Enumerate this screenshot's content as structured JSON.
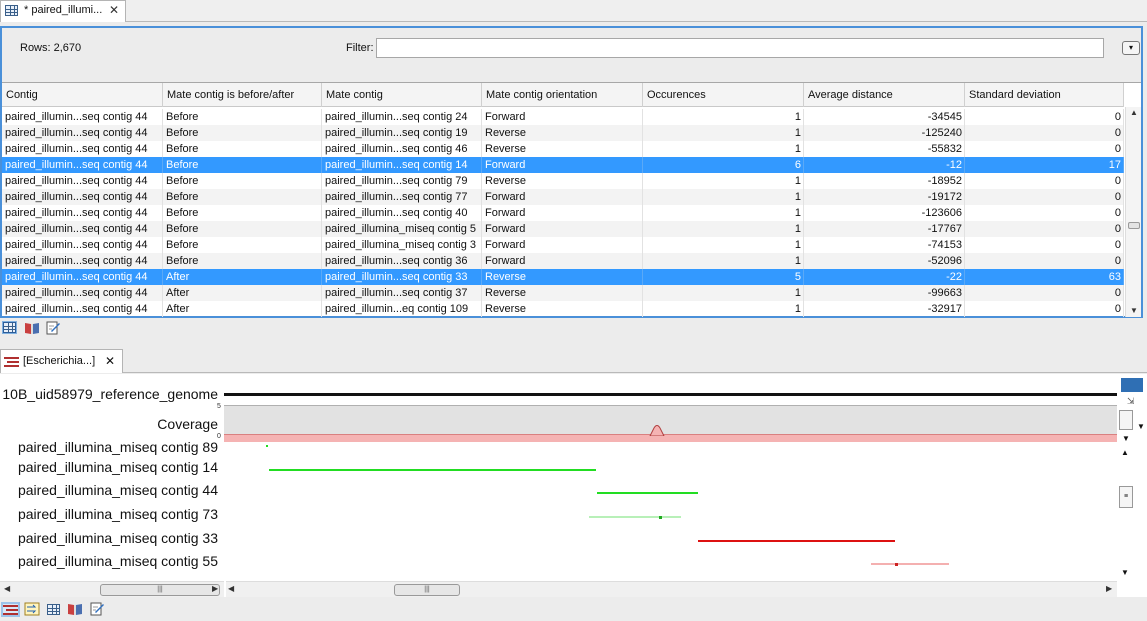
{
  "top_tab": {
    "title": "* paired_illumi..."
  },
  "table_view": {
    "rows_count_label": "Rows: 2,670",
    "filter_label": "Filter:",
    "filter_value": "",
    "columns": [
      "Contig",
      "Mate contig is before/after",
      "Mate contig",
      "Mate contig orientation",
      "Occurences",
      "Average distance",
      "Standard deviation"
    ],
    "rows": [
      {
        "contig": "paired_illumin...seq contig 44",
        "before_after": "Before",
        "mate": "paired_illumin...seq contig 24",
        "orientation": "Forward",
        "occ": "1",
        "avg": "-34545",
        "std": "0",
        "selected": false
      },
      {
        "contig": "paired_illumin...seq contig 44",
        "before_after": "Before",
        "mate": "paired_illumin...seq contig 19",
        "orientation": "Reverse",
        "occ": "1",
        "avg": "-125240",
        "std": "0",
        "selected": false
      },
      {
        "contig": "paired_illumin...seq contig 44",
        "before_after": "Before",
        "mate": "paired_illumin...seq contig 46",
        "orientation": "Reverse",
        "occ": "1",
        "avg": "-55832",
        "std": "0",
        "selected": false
      },
      {
        "contig": "paired_illumin...seq contig 44",
        "before_after": "Before",
        "mate": "paired_illumin...seq contig 14",
        "orientation": "Forward",
        "occ": "6",
        "avg": "-12",
        "std": "17",
        "selected": true
      },
      {
        "contig": "paired_illumin...seq contig 44",
        "before_after": "Before",
        "mate": "paired_illumin...seq contig 79",
        "orientation": "Reverse",
        "occ": "1",
        "avg": "-18952",
        "std": "0",
        "selected": false
      },
      {
        "contig": "paired_illumin...seq contig 44",
        "before_after": "Before",
        "mate": "paired_illumin...seq contig 77",
        "orientation": "Forward",
        "occ": "1",
        "avg": "-19172",
        "std": "0",
        "selected": false
      },
      {
        "contig": "paired_illumin...seq contig 44",
        "before_after": "Before",
        "mate": "paired_illumin...seq contig 40",
        "orientation": "Forward",
        "occ": "1",
        "avg": "-123606",
        "std": "0",
        "selected": false
      },
      {
        "contig": "paired_illumin...seq contig 44",
        "before_after": "Before",
        "mate": "paired_illumina_miseq contig 5",
        "orientation": "Forward",
        "occ": "1",
        "avg": "-17767",
        "std": "0",
        "selected": false
      },
      {
        "contig": "paired_illumin...seq contig 44",
        "before_after": "Before",
        "mate": "paired_illumina_miseq contig 3",
        "orientation": "Forward",
        "occ": "1",
        "avg": "-74153",
        "std": "0",
        "selected": false
      },
      {
        "contig": "paired_illumin...seq contig 44",
        "before_after": "Before",
        "mate": "paired_illumin...seq contig 36",
        "orientation": "Forward",
        "occ": "1",
        "avg": "-52096",
        "std": "0",
        "selected": false
      },
      {
        "contig": "paired_illumin...seq contig 44",
        "before_after": "After",
        "mate": "paired_illumin...seq contig 33",
        "orientation": "Reverse",
        "occ": "5",
        "avg": "-22",
        "std": "63",
        "selected": true
      },
      {
        "contig": "paired_illumin...seq contig 44",
        "before_after": "After",
        "mate": "paired_illumin...seq contig 37",
        "orientation": "Reverse",
        "occ": "1",
        "avg": "-99663",
        "std": "0",
        "selected": false
      },
      {
        "contig": "paired_illumin...seq contig 44",
        "before_after": "After",
        "mate": "paired_illumin...eq contig 109",
        "orientation": "Reverse",
        "occ": "1",
        "avg": "-32917",
        "std": "0",
        "selected": false
      }
    ]
  },
  "bottom_tab": {
    "title": "[Escherichia...]"
  },
  "track_view": {
    "reference_label": "10B_uid58979_reference_genome",
    "coverage_label": "Coverage",
    "coverage_max": "5",
    "coverage_min": "0",
    "tracks": [
      {
        "label": "paired_illumina_miseq contig 89",
        "color": "#22dd22"
      },
      {
        "label": "paired_illumina_miseq contig 14",
        "color": "#22dd22"
      },
      {
        "label": "paired_illumina_miseq contig 44",
        "color": "#22dd22"
      },
      {
        "label": "paired_illumina_miseq contig 73",
        "color": "#b8f0b8"
      },
      {
        "label": "paired_illumina_miseq contig 33",
        "color": "#dd1111"
      },
      {
        "label": "paired_illumina_miseq contig 55",
        "color": "#f4b0b0"
      }
    ]
  },
  "colors": {
    "selection": "#3399ff",
    "panel_border": "#4a90d9",
    "coverage_fill": "#f5b3b3"
  }
}
